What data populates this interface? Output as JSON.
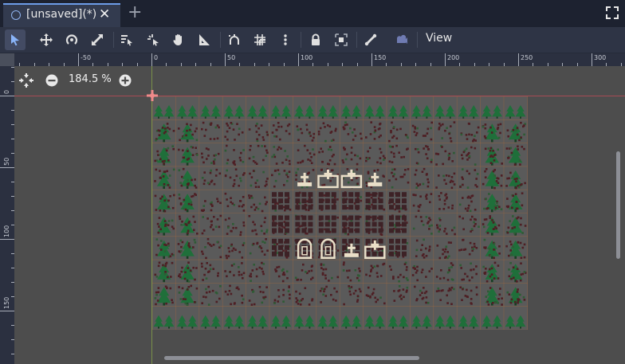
{
  "tab": {
    "title": "[unsaved](*)",
    "close_glyph": "✕",
    "add_glyph": "+"
  },
  "toolbar": {
    "view_label": "View",
    "icons": [
      "select-arrow-icon",
      "move-icon",
      "rotate-icon",
      "scale-icon",
      "list-select-icon",
      "pivot-icon",
      "pan-hand-icon",
      "ruler-icon",
      "smart-snap-icon",
      "grid-snap-icon",
      "more-options-icon",
      "lock-icon",
      "group-icon",
      "skeleton-bone-icon",
      "camera-override-icon"
    ]
  },
  "zoom": {
    "level": "184.5 %"
  },
  "ruler": {
    "top_labels": [
      "-50",
      "0",
      "50",
      "100",
      "150",
      "200",
      "250",
      "300"
    ],
    "left_labels": [
      "0",
      "50",
      "100",
      "150"
    ]
  },
  "colors": {
    "accent": "#6d9de8",
    "tree": "#1f6f3a",
    "soil": "#4e1f24",
    "tile_bg": "#5a5a5a",
    "grid": "#a86a3c",
    "axis_x": "#c64a57",
    "axis_y": "#8aa84a",
    "object": "#eadfc8"
  }
}
